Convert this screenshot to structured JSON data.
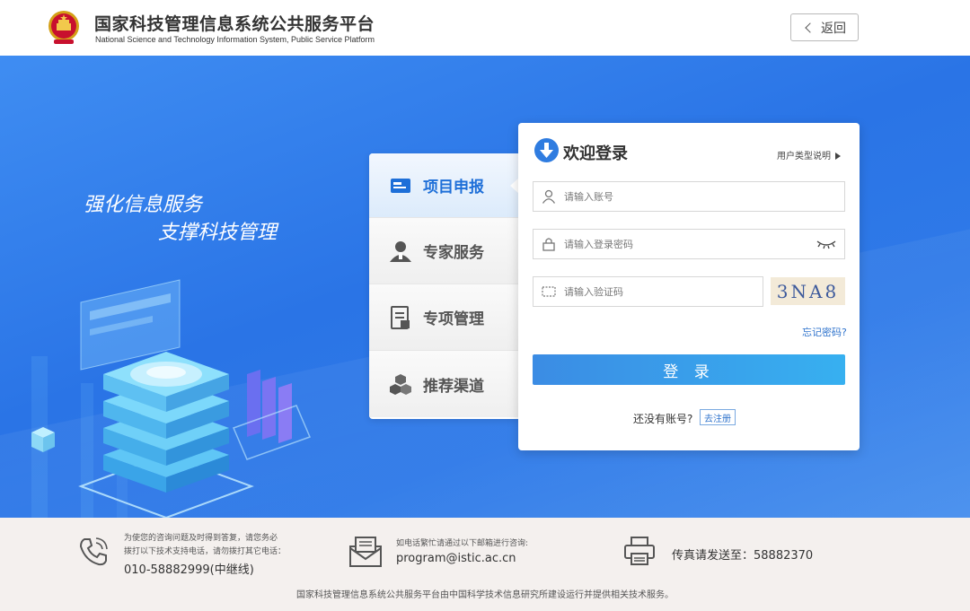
{
  "header": {
    "title_cn": "国家科技管理信息系统公共服务平台",
    "title_en": "National Science and Technology Information System, Public Service Platform",
    "back_label": "返回"
  },
  "hero": {
    "slogan_line1": "强化信息服务",
    "slogan_line2": "支撑科技管理"
  },
  "tabs": [
    {
      "label": "项目申报",
      "icon": "card-icon",
      "active": true
    },
    {
      "label": "专家服务",
      "icon": "expert-icon",
      "active": false
    },
    {
      "label": "专项管理",
      "icon": "document-icon",
      "active": false
    },
    {
      "label": "推荐渠道",
      "icon": "cubes-icon",
      "active": false
    }
  ],
  "login": {
    "title": "欢迎登录",
    "user_type_link": "用户类型说明",
    "account_placeholder": "请输入账号",
    "password_placeholder": "请输入登录密码",
    "captcha_placeholder": "请输入验证码",
    "captcha_text": "3NA8",
    "forgot_label": "忘记密码?",
    "submit_label": "登 录",
    "no_account_text": "还没有账号?",
    "register_label": "去注册"
  },
  "footer": {
    "phone_note_line1": "为使您的咨询问题及时得到答复，请您务必",
    "phone_note_line2": "拨打以下技术支持电话，请勿拨打其它电话：",
    "phone_number": "010-58882999(中继线)",
    "email_note": "如电话繁忙请通过以下邮箱进行咨询:",
    "email": "program@istic.ac.cn",
    "fax_text": "传真请发送至：58882370",
    "copyright": "国家科技管理信息系统公共服务平台由中国科学技术信息研究所建设运行并提供相关技术服务。"
  },
  "colors": {
    "brand_blue": "#2f7ce0",
    "hero_blue": "#2a74e6",
    "button_gradient_start": "#3b8ce4",
    "button_gradient_end": "#37b0f0",
    "footer_bg": "#f4f0ee"
  }
}
